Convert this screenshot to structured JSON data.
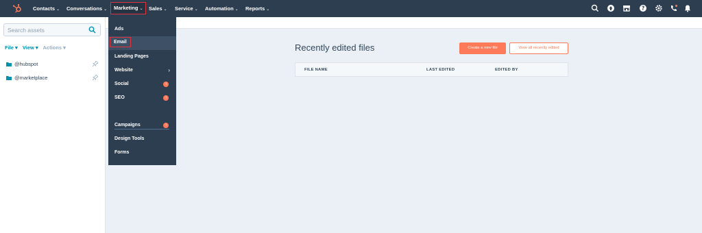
{
  "nav": {
    "items": [
      {
        "label": "Contacts",
        "caret": "⌄"
      },
      {
        "label": "Conversations",
        "caret": "⌄"
      },
      {
        "label": "Marketing",
        "caret": "⌄"
      },
      {
        "label": "Sales",
        "caret": "⌄"
      },
      {
        "label": "Service",
        "caret": "⌄"
      },
      {
        "label": "Automation",
        "caret": "⌄"
      },
      {
        "label": "Reports",
        "caret": "⌄"
      }
    ],
    "icons": [
      "search-icon",
      "upgrade-icon",
      "marketplace-icon",
      "help-icon",
      "settings-icon",
      "calling-icon",
      "notifications-icon"
    ],
    "brand_color": "#ff7a59",
    "bg_color": "#2d3e50"
  },
  "marketing_menu": {
    "items": [
      {
        "label": "Ads"
      },
      {
        "label": "Email"
      },
      {
        "label": "Landing Pages"
      },
      {
        "label": "Website",
        "arrow": "›"
      },
      {
        "label": "Social",
        "badge": "↑"
      },
      {
        "label": "SEO",
        "badge": "↑"
      },
      {
        "label": "Campaigns",
        "badge": "↑"
      },
      {
        "label": "Design Tools"
      },
      {
        "label": "Forms"
      }
    ]
  },
  "sidebar": {
    "search_placeholder": "Search assets",
    "file_menu": {
      "file": "File ▾",
      "view": "View ▾",
      "actions": "Actions ▾"
    },
    "folders": [
      {
        "label": "@hubspot"
      },
      {
        "label": "@marketplace"
      }
    ]
  },
  "main": {
    "title": "Recently edited files",
    "create_button": "Create a new file",
    "view_all_button": "View all recently edited",
    "columns": [
      "FILE NAME",
      "LAST EDITED",
      "EDITED BY"
    ]
  }
}
